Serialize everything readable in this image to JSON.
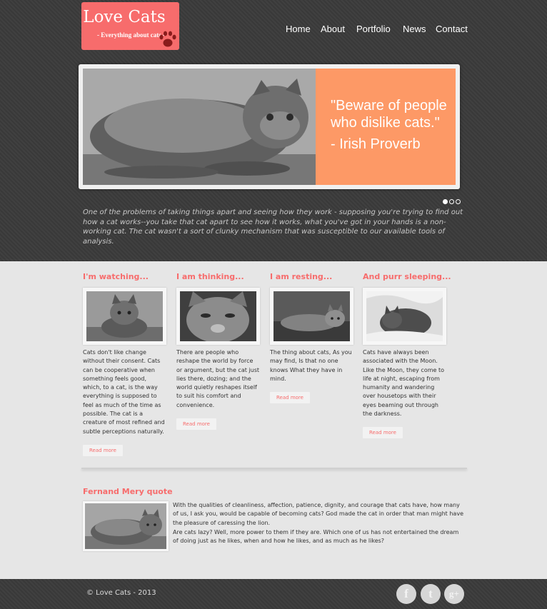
{
  "brand": {
    "title": "Love Cats",
    "tagline": "- Everything about cats -",
    "color": "#f76c6c"
  },
  "nav": {
    "items": [
      {
        "label": "Home"
      },
      {
        "label": "About"
      },
      {
        "label": "Portfolio"
      },
      {
        "label": "News"
      },
      {
        "label": "Contact"
      }
    ]
  },
  "slider": {
    "quote": "\"Beware of people who dislike cats.\"",
    "author": "- Irish Proverb",
    "quote_bg": "#fd9966",
    "dots": 3,
    "active_dot": 1
  },
  "intro": "One of the problems of taking things apart and seeing how they work - supposing you're trying to find out how a cat works--you take that cat apart to see how it works, what you've got in your hands is a non-working cat. The cat wasn't a sort of clunky mechanism that was susceptible to our available tools of analysis.",
  "columns": [
    {
      "title": "I'm watching...",
      "text": "Cats don't like change without their consent. Cats can be cooperative when something feels good, which, to a cat, is the way everything is supposed to feel as much of the time as possible. The cat is a creature of most refined and subtle perceptions naturally.",
      "button": "Read more"
    },
    {
      "title": "I am thinking...",
      "text": "There are people who reshape the world by force or argument, but the cat just lies there, dozing; and the world quietly reshapes itself to suit his comfort and convenience.",
      "button": "Read more"
    },
    {
      "title": "I am resting...",
      "text": "The thing about cats, As you may find, Is that no one knows What they have in mind.",
      "button": "Read more"
    },
    {
      "title": "And purr sleeping...",
      "text": "Cats have always been associated with the Moon. Like the Moon, they come to life at night, escaping from humanity and wandering over housetops with their eyes beaming out through the darkness.",
      "button": "Read more"
    }
  ],
  "quote_section": {
    "title": "Fernand Mery quote",
    "paragraphs": [
      "With the qualities of cleanliness, affection, patience, dignity, and courage that cats have, how many of us, I ask you, would be capable of becoming cats? God made the cat in order that man might have the pleasure of caressing the lion.",
      "Are cats lazy? Well, more power to them if they are. Which one of us has not entertained the dream of doing just as he likes, when and how he likes, and as much as he likes?"
    ]
  },
  "footer": {
    "copyright": "© Love Cats - 2013",
    "social": [
      {
        "icon": "facebook-icon",
        "glyph": "f"
      },
      {
        "icon": "twitter-icon",
        "glyph": "t"
      },
      {
        "icon": "google-plus-icon",
        "glyph": "g+"
      }
    ]
  }
}
